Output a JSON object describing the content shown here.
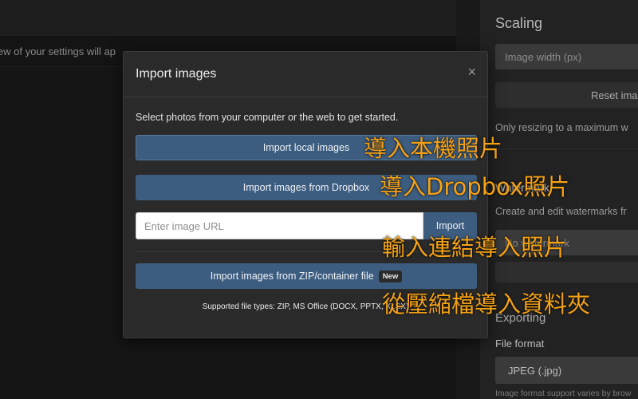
{
  "background": {
    "preview_text": "iew of your settings will ap",
    "panel": {
      "scaling_title": "Scaling",
      "width_placeholder": "Image width (px)",
      "reset_label": "Reset imag",
      "resize_note": "Only resizing to a maximum w",
      "watermark_title": "Watermark",
      "watermark_desc": "Create and edit watermarks fr",
      "watermark_select": "No watermark",
      "exporting_title": "Exporting",
      "file_format_label": "File format",
      "file_format_value": "JPEG (.jpg)",
      "format_support": "Image format support varies by brow"
    }
  },
  "modal": {
    "title": "Import images",
    "close_glyph": "×",
    "intro": "Select photos from your computer or the web to get started.",
    "local_label": "Import local images",
    "dropbox_label": "Import images from Dropbox",
    "url_placeholder": "Enter image URL",
    "url_import_label": "Import",
    "zip_label": "Import images from ZIP/container file",
    "zip_badge": "New",
    "supported": "Supported file types: ZIP, MS Office (DOCX, PPTX, XLSX)"
  },
  "annotations": {
    "local": "導入本機照片",
    "dropbox": "導入Dropbox照片",
    "url": "輸入連結導入照片",
    "zip": "從壓縮檔導入資料夾"
  },
  "colors": {
    "accent_blue": "#3d5d80",
    "annotation_orange": "#f5a216",
    "modal_bg": "#2a2a2a"
  }
}
